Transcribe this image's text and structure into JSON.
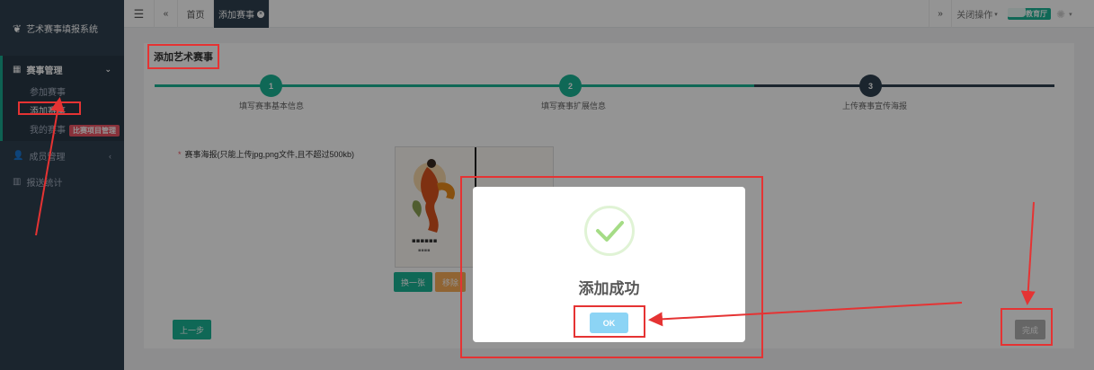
{
  "app": {
    "title": "艺术赛事填报系统"
  },
  "sidebar": {
    "sections": [
      {
        "label": "赛事管理",
        "icon": "grid-icon",
        "expanded": true,
        "items": [
          {
            "label": "参加赛事"
          },
          {
            "label": "添加赛事",
            "current": true
          },
          {
            "label": "我的赛事",
            "badge": "比赛项目管理"
          }
        ]
      },
      {
        "label": "成员管理",
        "icon": "user-icon"
      },
      {
        "label": "报送统计",
        "icon": "bar-chart-icon"
      }
    ]
  },
  "topbar": {
    "tabs": [
      {
        "label": "首页"
      },
      {
        "label": "添加赛事",
        "active": true
      }
    ],
    "close_ops_label": "关闭操作",
    "user_badge": "教育厅"
  },
  "page": {
    "title": "添加艺术赛事",
    "steps": [
      {
        "number": "1",
        "label": "填写赛事基本信息"
      },
      {
        "number": "2",
        "label": "填写赛事扩展信息"
      },
      {
        "number": "3",
        "label": "上传赛事宣传海报"
      }
    ],
    "poster_field_label": "赛事海报(只能上传jpg,png文件,且不超过500kb)",
    "replace_label": "换一张",
    "remove_label": "移除",
    "prev_label": "上一步",
    "finish_label": "完成"
  },
  "dialog": {
    "title": "添加成功",
    "ok_label": "OK"
  },
  "colors": {
    "sidebar_bg": "#2f4050",
    "accent": "#1ab394",
    "step_pending": "#2f4050",
    "annotation_red": "#e53333",
    "ok_button": "#8cd4f5"
  }
}
